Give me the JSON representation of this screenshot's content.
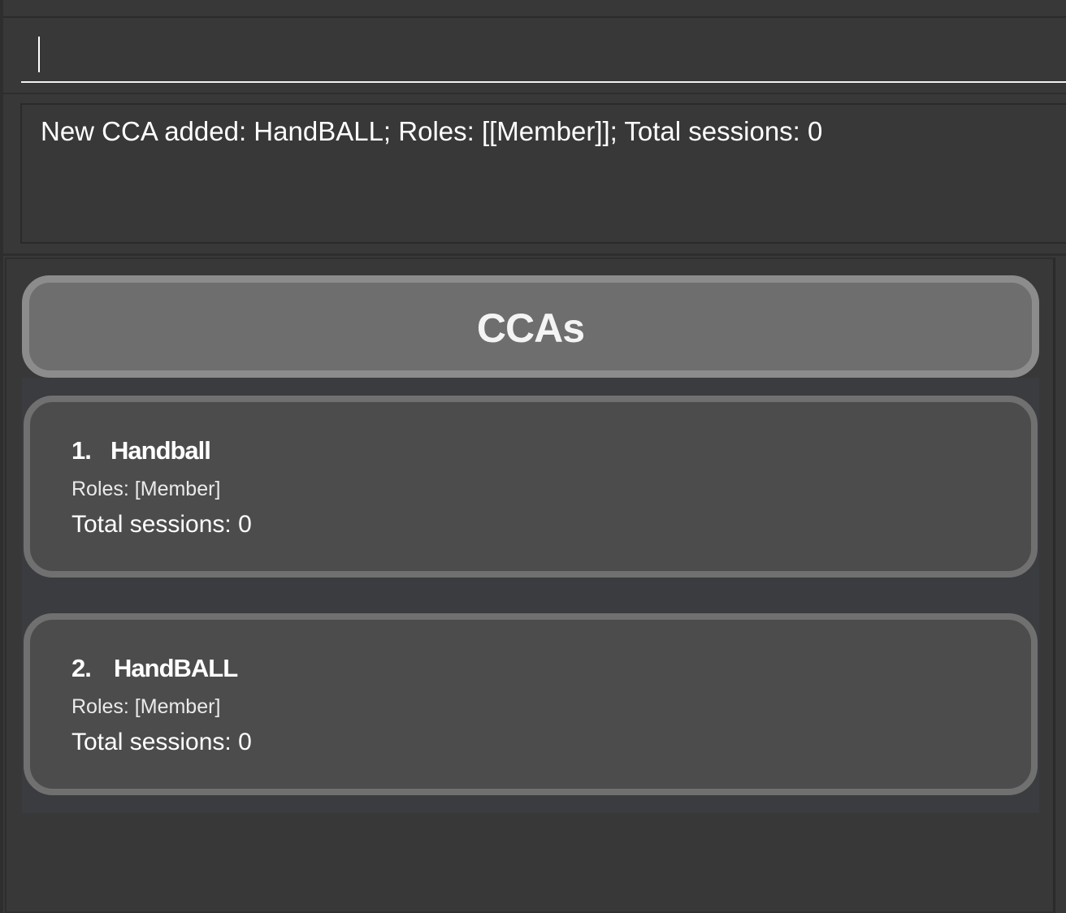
{
  "command_box": {
    "value": ""
  },
  "result_display": {
    "message": "New CCA added: HandBALL; Roles: [[Member]]; Total sessions: 0"
  },
  "cca_list": {
    "title": "CCAs",
    "items": [
      {
        "index": "1.",
        "name": "Handball",
        "roles": "Roles: [Member]",
        "sessions": "Total sessions: 0"
      },
      {
        "index": "2.",
        "name": "HandBALL",
        "roles": "Roles: [Member]",
        "sessions": "Total sessions: 0"
      }
    ]
  },
  "colors": {
    "background": "#383838",
    "header_card": "#6e6e6e",
    "list_card": "#4c4c4c",
    "card_border": "#707070",
    "text": "#ffffff"
  }
}
